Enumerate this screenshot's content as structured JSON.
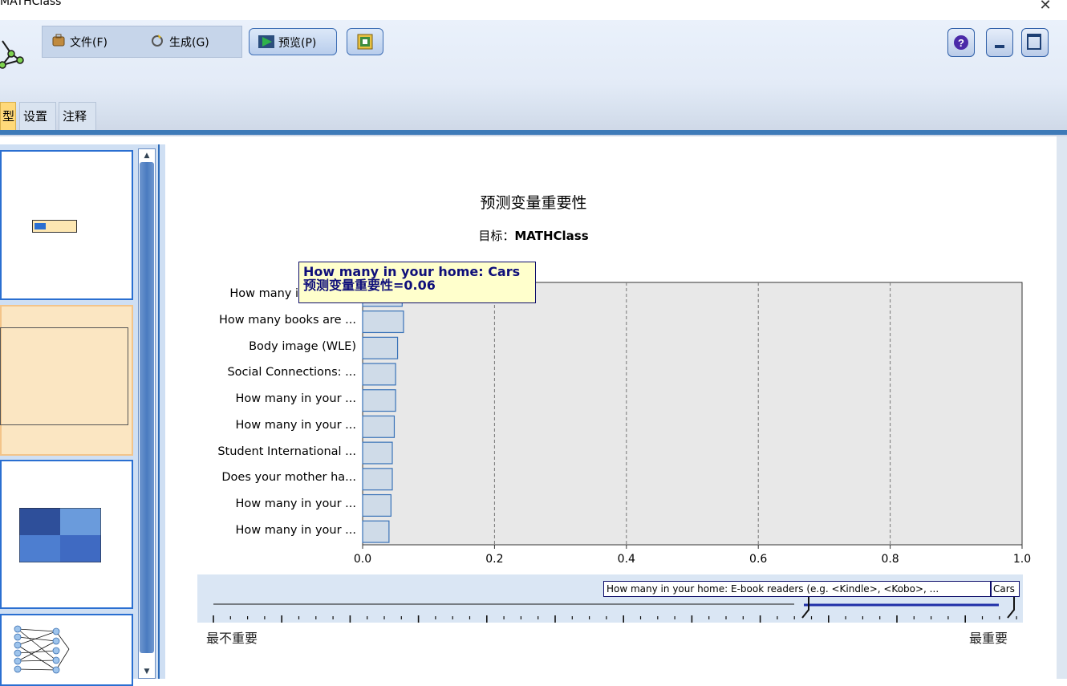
{
  "window": {
    "title": "MATHClass"
  },
  "menu": {
    "file": "文件(F)",
    "generate": "生成(G)"
  },
  "toolbar": {
    "preview": "预览(P)"
  },
  "tabs": [
    "型",
    "设置",
    "注释"
  ],
  "chart_data": {
    "type": "bar",
    "orientation": "horizontal",
    "title": "预测变量重要性",
    "subtitle_prefix": "目标：",
    "subtitle_target": "MATHClass",
    "categories": [
      "How many i",
      "How many books are ...",
      "Body image (WLE)",
      "Social Connections: ...",
      "How many in your ...",
      "How many in your ...",
      "Student International ...",
      "Does your mother ha...",
      "How many in your ...",
      "How many in your ..."
    ],
    "values": [
      0.06,
      0.062,
      0.053,
      0.05,
      0.05,
      0.048,
      0.045,
      0.045,
      0.043,
      0.04
    ],
    "xlim": [
      0,
      1
    ],
    "xticks": [
      "0.0",
      "0.2",
      "0.4",
      "0.6",
      "0.8",
      "1.0"
    ],
    "grid": "vertical dashed",
    "bar_fill": "#cfdbe8",
    "bar_stroke": "#3a73b8",
    "plot_bg": "#e8e8e8"
  },
  "tooltip": {
    "line1": "How many in your home: Cars",
    "line2": "预测变量重要性=0.06"
  },
  "slider": {
    "label_left": "How many in your home: E-book readers (e.g. <Kindle>, <Kobo>, ...",
    "label_right": "Cars",
    "low": "最不重要",
    "high": "最重要"
  },
  "colors": {
    "accent": "#2a6fd1",
    "selected": "#ffd97a"
  }
}
